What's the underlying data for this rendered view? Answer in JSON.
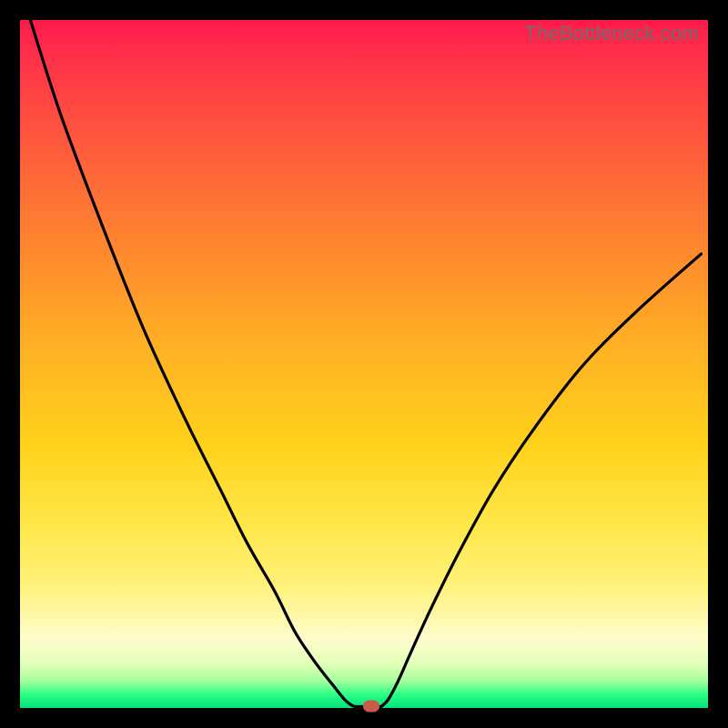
{
  "watermark": "TheBottleneck.com",
  "colors": {
    "frame": "#000000",
    "curve_stroke": "#000000",
    "marker_fill": "#c95b4a"
  },
  "chart_data": {
    "type": "line",
    "title": "",
    "xlabel": "",
    "ylabel": "",
    "xlim": [
      0,
      100
    ],
    "ylim": [
      0,
      100
    ],
    "grid": false,
    "series": [
      {
        "name": "bottleneck-curve-left",
        "x": [
          1.5,
          6,
          12,
          18,
          24,
          29,
          33,
          37,
          40,
          43,
          45.5,
          47.2,
          48.3,
          48.8
        ],
        "y": [
          100,
          86,
          70,
          55,
          42,
          32,
          24,
          17,
          11,
          6.5,
          3.3,
          1.2,
          0.35,
          0.2
        ]
      },
      {
        "name": "bottleneck-curve-right",
        "x": [
          52.5,
          53.5,
          55,
          57,
          60,
          64,
          69,
          75,
          82,
          90,
          99
        ],
        "y": [
          0.2,
          1.2,
          4.0,
          8.5,
          15,
          23,
          32,
          41,
          50,
          58,
          66
        ]
      },
      {
        "name": "bottleneck-floor",
        "x": [
          48.8,
          52.5
        ],
        "y": [
          0.2,
          0.2
        ]
      }
    ],
    "marker": {
      "x": 51.0,
      "y": 0.2
    },
    "gradient_stops": [
      {
        "pos": 0.0,
        "color": "#ff1a4d"
      },
      {
        "pos": 0.18,
        "color": "#ff5a3d"
      },
      {
        "pos": 0.48,
        "color": "#ffb224"
      },
      {
        "pos": 0.82,
        "color": "#fff178"
      },
      {
        "pos": 0.96,
        "color": "#a8ff9e"
      },
      {
        "pos": 1.0,
        "color": "#00e37a"
      }
    ]
  }
}
